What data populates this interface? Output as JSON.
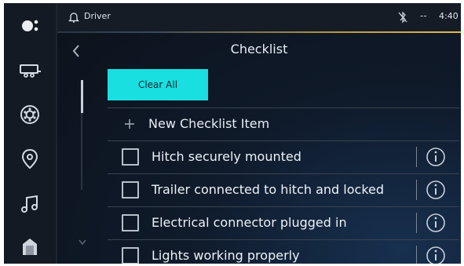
{
  "statusbar": {
    "profile": "Driver",
    "separator": "--",
    "time": "4:40"
  },
  "rail": {
    "items": [
      {
        "icon": "assistant-icon"
      },
      {
        "icon": "trailer-icon"
      },
      {
        "icon": "apps-icon"
      },
      {
        "icon": "location-pin-icon"
      },
      {
        "icon": "music-note-icon"
      },
      {
        "icon": "phone-icon"
      }
    ]
  },
  "header": {
    "title": "Checklist"
  },
  "checklist": {
    "clear_all_label": "Clear All",
    "new_item_label": "New Checklist Item",
    "items": [
      {
        "label": "Hitch securely mounted",
        "checked": false
      },
      {
        "label": "Trailer connected to hitch and locked",
        "checked": false
      },
      {
        "label": "Electrical connector plugged in",
        "checked": false
      },
      {
        "label": "Lights working properly",
        "checked": false
      }
    ]
  },
  "colors": {
    "accent": "#19dfe0",
    "status_gold": "#e1b954",
    "background": "#0d131c"
  }
}
